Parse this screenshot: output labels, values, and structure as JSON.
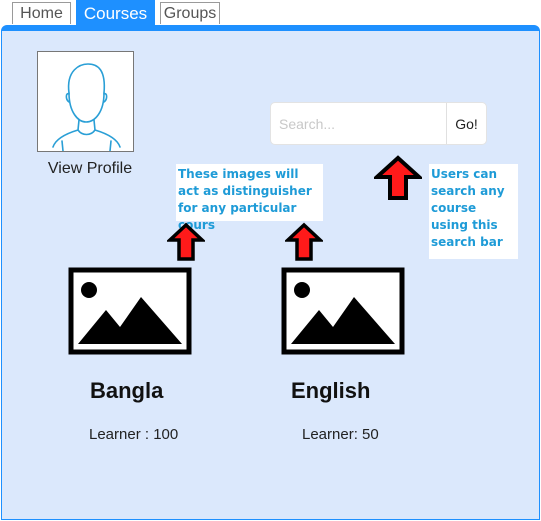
{
  "tabs": [
    {
      "label": "Home"
    },
    {
      "label": "Courses"
    },
    {
      "label": "Groups"
    }
  ],
  "profile": {
    "view_label": "View Profile"
  },
  "search": {
    "placeholder": "Search...",
    "button_label": "Go!"
  },
  "notes": {
    "images": "These images will act as distinguisher for any particular cours",
    "search": "Users can search any course using this search bar"
  },
  "courses": [
    {
      "title": "Bangla",
      "learners": "Learner : 100"
    },
    {
      "title": "English",
      "learners": "Learner: 50"
    }
  ],
  "colors": {
    "accent": "#1e90ff",
    "panel": "#dbe8fc",
    "note_text": "#1e9bd7",
    "arrow": "#ff1a1a"
  },
  "icons": {
    "avatar": "user-avatar-icon",
    "course": "image-placeholder-icon",
    "arrow": "up-arrow-icon"
  }
}
